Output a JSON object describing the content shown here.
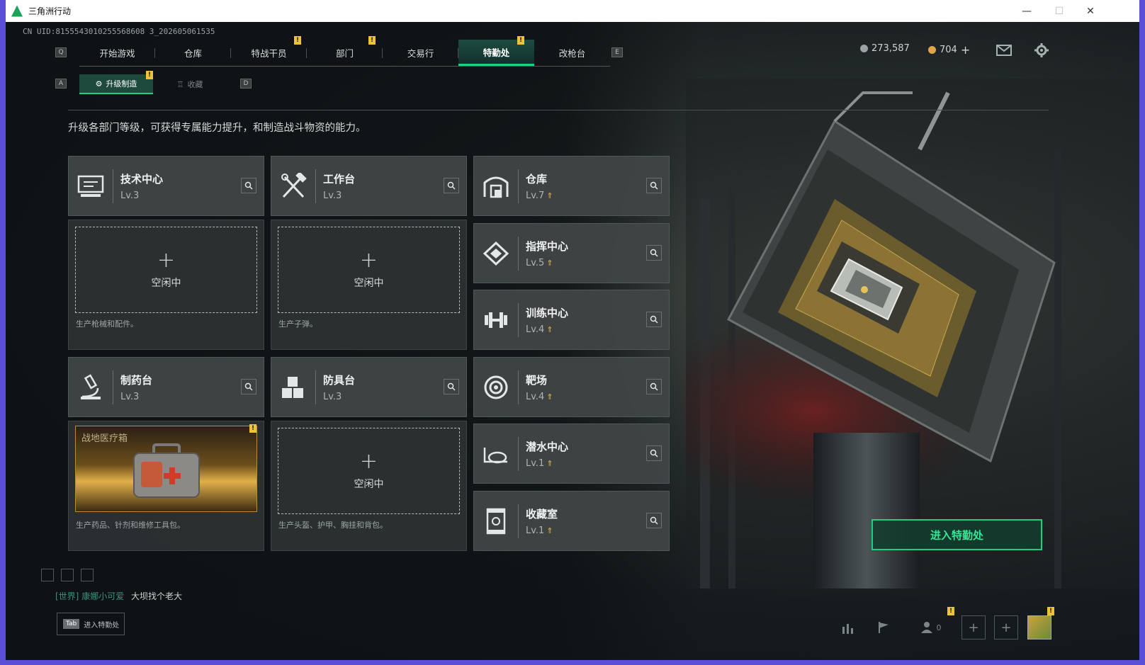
{
  "window": {
    "title": "三角洲行动",
    "minimize": "—",
    "maximize": "☐",
    "close": "✕"
  },
  "uid": "CN UID:8155543010255568608 3_202605061535",
  "hotkeys": {
    "left": "Q",
    "right": "E",
    "sub_left": "A",
    "sub_right": "D"
  },
  "nav": {
    "tabs": [
      {
        "label": "开始游戏"
      },
      {
        "label": "仓库"
      },
      {
        "label": "特战干员"
      },
      {
        "label": "部门"
      },
      {
        "label": "交易行"
      },
      {
        "label": "特勤处"
      },
      {
        "label": "改枪台"
      }
    ],
    "selected": "特勤处"
  },
  "currency": {
    "coins": "273,587",
    "premium": "704",
    "add": "+"
  },
  "subtabs": [
    {
      "label": "升级制造"
    },
    {
      "label": "收藏"
    }
  ],
  "description": "升级各部门等级，可获得专属能力提升，和制造战斗物资的能力。",
  "facilities": {
    "tech": {
      "name": "技术中心",
      "level": "Lv.3",
      "slot": "空闲中",
      "slot_desc": "生产枪械和配件。"
    },
    "workbench": {
      "name": "工作台",
      "level": "Lv.3",
      "slot": "空闲中",
      "slot_desc": "生产子弹。"
    },
    "pharmacy": {
      "name": "制药台",
      "level": "Lv.3",
      "slot_item": "战地医疗箱",
      "slot_desc": "生产药品、针剂和维修工具包。"
    },
    "armor": {
      "name": "防具台",
      "level": "Lv.3",
      "slot": "空闲中",
      "slot_desc": "生产头盔、护甲、胸挂和背包。"
    },
    "storage": {
      "name": "仓库",
      "level": "Lv.7"
    },
    "command": {
      "name": "指挥中心",
      "level": "Lv.5"
    },
    "training": {
      "name": "训练中心",
      "level": "Lv.4"
    },
    "range": {
      "name": "靶场",
      "level": "Lv.4"
    },
    "diving": {
      "name": "潜水中心",
      "level": "Lv.1"
    },
    "collection": {
      "name": "收藏室",
      "level": "Lv.1"
    }
  },
  "plus_sign": "+",
  "enter_button": "进入特勤处",
  "chat": {
    "channel": "[世界]",
    "user": "康娜小可爱",
    "message": "大坝找个老大"
  },
  "tab_hint": {
    "key": "Tab",
    "label": "进入特勤处"
  },
  "friends_count": "0",
  "colors": {
    "accent": "#1fcf80",
    "badge": "#f0c23a",
    "upgrade": "#e6b84a"
  }
}
